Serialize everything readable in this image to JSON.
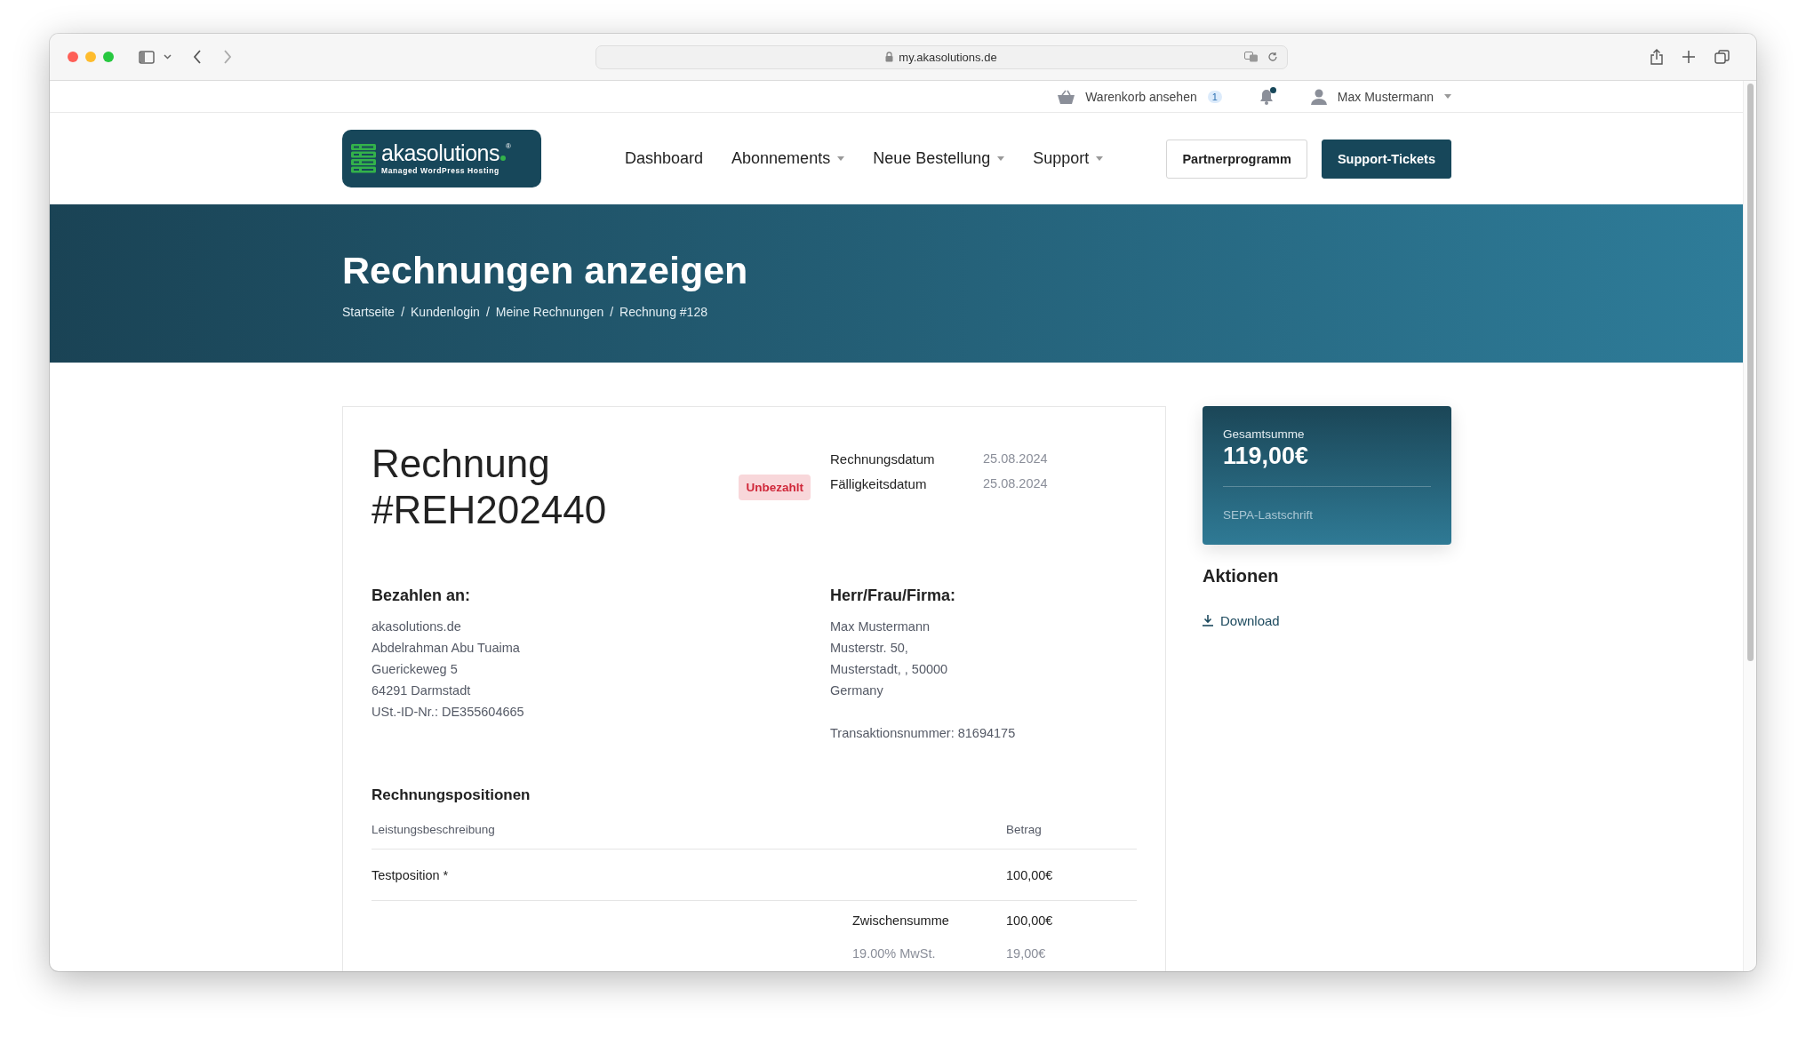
{
  "browser": {
    "url": "my.akasolutions.de"
  },
  "top_bar": {
    "cart": {
      "label": "Warenkorb ansehen",
      "count": "1"
    },
    "notifications": {
      "unread": true
    },
    "user": {
      "name": "Max Mustermann"
    }
  },
  "logo": {
    "name": "akasolutions",
    "mark": "®",
    "tagline": "Managed WordPress Hosting"
  },
  "nav": {
    "items": [
      {
        "label": "Dashboard",
        "has_menu": false
      },
      {
        "label": "Abonnements",
        "has_menu": true
      },
      {
        "label": "Neue Bestellung",
        "has_menu": true
      },
      {
        "label": "Support",
        "has_menu": true
      }
    ],
    "buttons": [
      {
        "label": "Partnerprogramm",
        "kind": "outline"
      },
      {
        "label": "Support-Tickets",
        "kind": "primary"
      }
    ]
  },
  "hero": {
    "title": "Rechnungen anzeigen",
    "separator": "/",
    "breadcrumbs": [
      "Startseite",
      "Kundenlogin",
      "Meine Rechnungen",
      "Rechnung #128"
    ]
  },
  "invoice": {
    "title": "Rechnung #REH202440",
    "status": {
      "label": "Unbezahlt",
      "kind": "unpaid"
    },
    "dates": [
      {
        "label": "Rechnungsdatum",
        "value": "25.08.2024"
      },
      {
        "label": "Fälligkeitsdatum",
        "value": "25.08.2024"
      }
    ],
    "pay_to": {
      "heading": "Bezahlen an:",
      "lines": [
        "akasolutions.de",
        "Abdelrahman Abu Tuaima",
        "Guerickeweg 5",
        "64291 Darmstadt",
        "USt.-ID-Nr.: DE355604665"
      ]
    },
    "bill_to": {
      "heading": "Herr/Frau/Firma:",
      "lines": [
        "Max Mustermann",
        "Musterstr. 50,",
        "Musterstadt, , 50000",
        "Germany"
      ],
      "transaction": "Transaktionsnummer: 81694175"
    },
    "items": {
      "heading": "Rechnungspositionen",
      "columns": [
        "Leistungsbeschreibung",
        "Betrag"
      ],
      "rows": [
        {
          "description": "Testposition *",
          "amount": "100,00€"
        }
      ],
      "totals": [
        {
          "label": "Zwischensumme",
          "value": "100,00€",
          "kind": "subtotal"
        },
        {
          "label": "19.00% MwSt.",
          "value": "19,00€",
          "kind": "tax"
        }
      ]
    }
  },
  "summary": {
    "label": "Gesamtsumme",
    "total": "119,00€",
    "method": "SEPA-Lastschrift"
  },
  "actions": {
    "heading": "Aktionen",
    "links": [
      {
        "label": "Download"
      }
    ]
  }
}
